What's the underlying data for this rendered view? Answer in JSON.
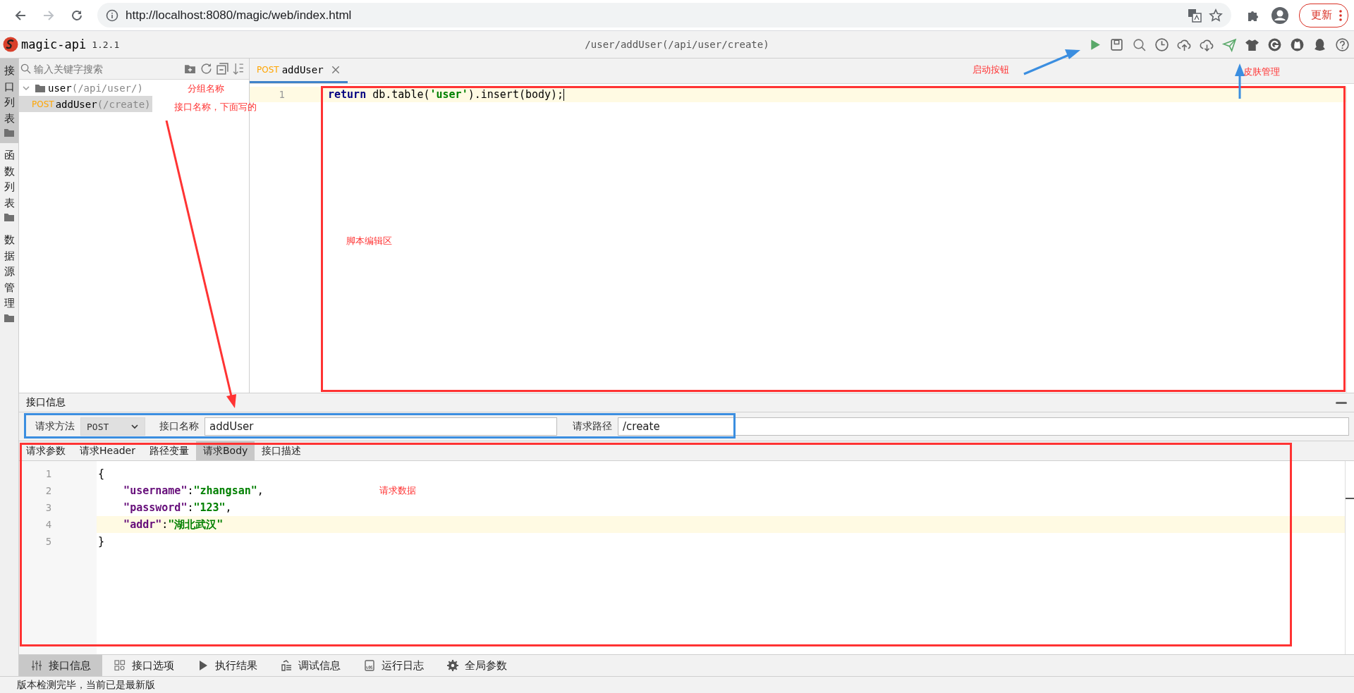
{
  "browser": {
    "url": "http://localhost:8080/magic/web/index.html",
    "update_button": "更新"
  },
  "app": {
    "name": "magic-api",
    "version": "1.2.1",
    "path": "/user/addUser(/api/user/create)"
  },
  "side_tabs": [
    {
      "label": "接口列表",
      "selected": true
    },
    {
      "label": "函数列表",
      "selected": false
    },
    {
      "label": "数据源管理",
      "selected": false
    }
  ],
  "search": {
    "placeholder": "输入关键字搜索"
  },
  "tree": [
    {
      "label": "user",
      "path": "(/api/user/)",
      "expanded": true,
      "children": [
        {
          "method": "POST",
          "label": "addUser",
          "path": "(/create)",
          "selected": true
        }
      ]
    }
  ],
  "editor": {
    "tabs": [
      {
        "method": "POST",
        "label": "addUser",
        "selected": true
      }
    ],
    "lines": [
      {
        "number": "1",
        "highlighted": true,
        "tokens": [
          {
            "kind": "keyword",
            "text": "return"
          },
          {
            "kind": "plain",
            "text": " db.table("
          },
          {
            "kind": "string",
            "text": "'user'"
          },
          {
            "kind": "plain",
            "text": ").insert(body);"
          }
        ]
      }
    ]
  },
  "info_panel": {
    "title": "接口信息",
    "method_label": "请求方法",
    "method": "POST",
    "name_label": "接口名称",
    "name": "addUser",
    "path_label": "请求路径",
    "path": "/create"
  },
  "request_tabs": [
    {
      "label": "请求参数",
      "selected": false
    },
    {
      "label": "请求Header",
      "selected": false
    },
    {
      "label": "路径变量",
      "selected": false
    },
    {
      "label": "请求Body",
      "selected": true
    },
    {
      "label": "接口描述",
      "selected": false
    }
  ],
  "body_lines": [
    {
      "number": "1",
      "highlighted": false,
      "indented": false,
      "tokens": [
        {
          "kind": "plain",
          "text": "{"
        }
      ]
    },
    {
      "number": "2",
      "highlighted": false,
      "indented": true,
      "tokens": [
        {
          "kind": "key",
          "text": "\"username\""
        },
        {
          "kind": "plain",
          "text": ":"
        },
        {
          "kind": "string",
          "text": "\"zhangsan\""
        },
        {
          "kind": "plain",
          "text": ","
        }
      ]
    },
    {
      "number": "3",
      "highlighted": false,
      "indented": true,
      "tokens": [
        {
          "kind": "key",
          "text": "\"password\""
        },
        {
          "kind": "plain",
          "text": ":"
        },
        {
          "kind": "string",
          "text": "\"123\""
        },
        {
          "kind": "plain",
          "text": ","
        }
      ]
    },
    {
      "number": "4",
      "highlighted": true,
      "indented": true,
      "tokens": [
        {
          "kind": "key",
          "text": "\"addr\""
        },
        {
          "kind": "plain",
          "text": ":"
        },
        {
          "kind": "string",
          "text": "\"湖北武汉\""
        }
      ]
    },
    {
      "number": "5",
      "highlighted": false,
      "indented": false,
      "tokens": [
        {
          "kind": "plain",
          "text": "}"
        }
      ]
    }
  ],
  "bottom_tabs": [
    {
      "label": "接口信息",
      "selected": true
    },
    {
      "label": "接口选项",
      "selected": false
    },
    {
      "label": "执行结果",
      "selected": false
    },
    {
      "label": "调试信息",
      "selected": false
    },
    {
      "label": "运行日志",
      "selected": false
    },
    {
      "label": "全局参数",
      "selected": false
    }
  ],
  "status_bar": "版本检测完毕，当前已是最新版",
  "annotations": [
    {
      "text": "分组名称"
    },
    {
      "text": "接口名称，下面写的"
    },
    {
      "text": "启动按钮"
    },
    {
      "text": "皮肤管理"
    },
    {
      "text": "脚本编辑区"
    },
    {
      "text": "请求数据"
    }
  ]
}
